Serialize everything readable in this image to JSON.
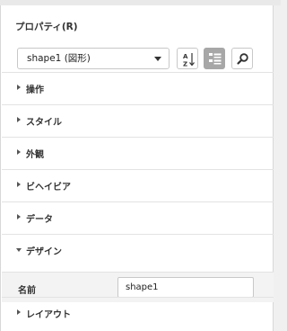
{
  "panel": {
    "title": "プロパティ(R)"
  },
  "object_selector": {
    "value": "shape1 (図形)"
  },
  "toolbar": {
    "sort_alpha_icon": "sort-alphabetical-icon",
    "categorized_icon": "categorized-view-icon",
    "search_icon": "search-icon"
  },
  "sections": [
    {
      "label": "操作",
      "expanded": false
    },
    {
      "label": "スタイル",
      "expanded": false
    },
    {
      "label": "外観",
      "expanded": false
    },
    {
      "label": "ビヘイビア",
      "expanded": false
    },
    {
      "label": "データ",
      "expanded": false
    },
    {
      "label": "デザイン",
      "expanded": true
    },
    {
      "label": "レイアウト",
      "expanded": false
    }
  ],
  "design_properties": [
    {
      "label": "名前",
      "value": "shape1"
    }
  ],
  "colors": {
    "active_button": "#a7a7a7",
    "row_highlight": "#f3f3f3"
  }
}
